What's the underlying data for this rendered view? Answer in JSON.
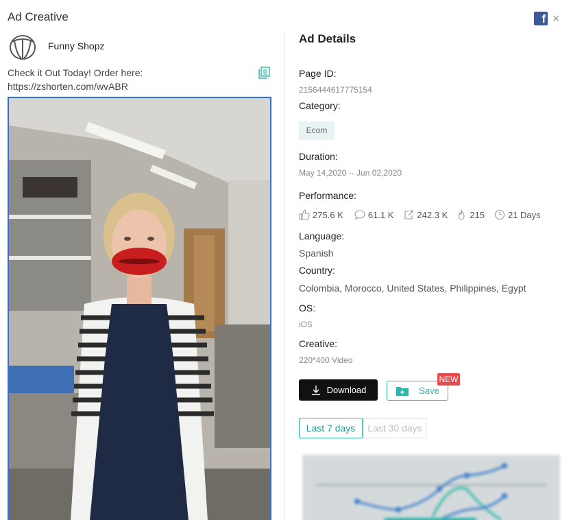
{
  "dialog": {
    "title": "Ad Creative",
    "facebook_glyph": "f",
    "close_glyph": "×"
  },
  "creative": {
    "page_name": "Funny Shopz",
    "ad_text_line1": "Check it Out Today! Order here:",
    "ad_text_line2": "https://zshorten.com/wvABR"
  },
  "details": {
    "heading": "Ad Details",
    "page_id_label": "Page ID:",
    "page_id": "2156444617775154",
    "category_label": "Category:",
    "category": "Ecom",
    "duration_label": "Duration:",
    "duration": "May 14,2020 -- Jun 02,2020",
    "performance_label": "Performance:",
    "performance": {
      "likes": "275.6 K",
      "comments": "61.1 K",
      "shares": "242.3 K",
      "hot": "215",
      "days": "21 Days"
    },
    "language_label": "Language:",
    "language": "Spanish",
    "country_label": "Country:",
    "country": "Colombia, Morocco, United States, Philippines, Egypt",
    "os_label": "OS:",
    "os": "iOS",
    "creative_label": "Creative:",
    "creative": "220*400 Video"
  },
  "actions": {
    "download": "Download",
    "save": "Save",
    "new_badge": "NEW"
  },
  "ranges": {
    "active": "Last 7 days",
    "inactive": "Last 30 days"
  },
  "colors": {
    "accent": "#2eb5a8",
    "download_bg": "#111111",
    "new_badge": "#e74c4c",
    "video_border": "#2f6fdb",
    "facebook": "#3b5998"
  },
  "icons": {
    "facebook": "facebook-icon",
    "close": "close-icon",
    "copy": "copy-icon",
    "likes": "thumbs-up-icon",
    "comments": "comment-icon",
    "shares": "share-icon",
    "hot": "flame-icon",
    "days": "clock-icon",
    "download": "download-icon",
    "save": "folder-plus-icon"
  }
}
